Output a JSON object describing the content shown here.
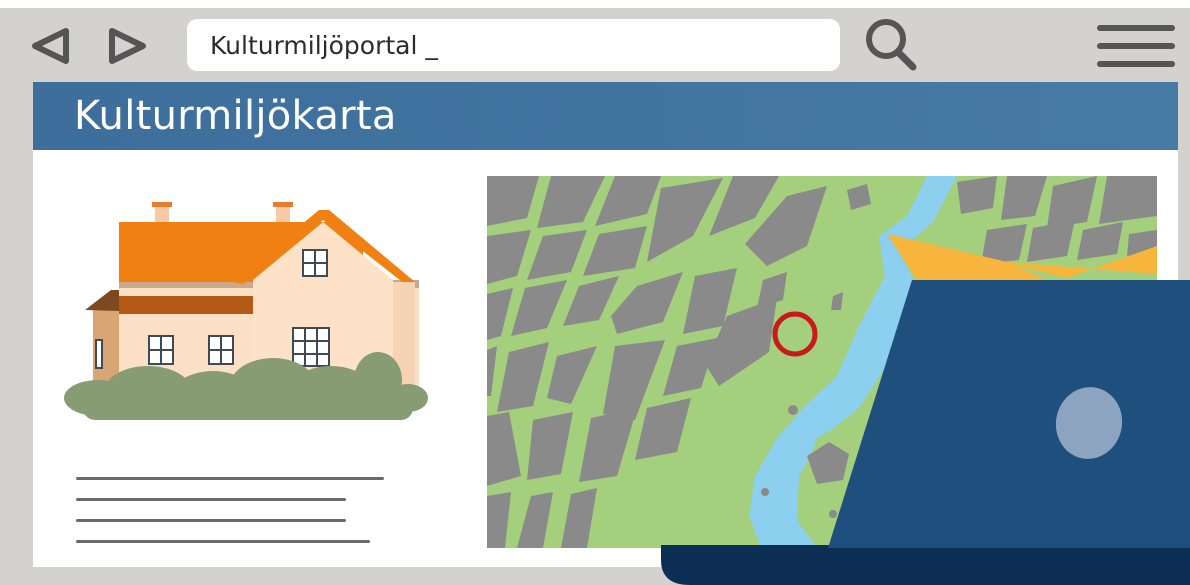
{
  "browser": {
    "address_text": "Kulturmiljöportal _",
    "back_icon": "triangle-left-icon",
    "forward_icon": "triangle-right-icon",
    "search_icon": "magnifier-icon",
    "menu_icon": "hamburger-menu-icon"
  },
  "page": {
    "title": "Kulturmiljökarta",
    "header_color": "#477aa4"
  },
  "illustrations": {
    "house": "house-illustration",
    "map": "city-map-illustration",
    "map_marker": "red-circle-marker",
    "laptop": "laptop-illustration"
  },
  "colors": {
    "frame": "#d3d2cf",
    "map_green": "#a4cf7c",
    "map_water": "#8ccfee",
    "map_blocks": "#8a8a8a",
    "highlight_area": "#f8b53d",
    "marker": "#c8191c",
    "laptop": "#1f4f7d"
  }
}
